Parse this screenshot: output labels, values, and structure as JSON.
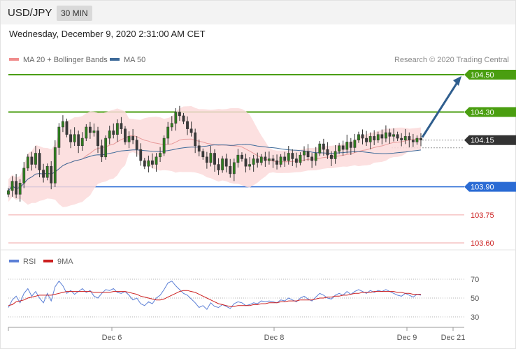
{
  "header": {
    "symbol": "USD/JPY",
    "timeframe": "30 MIN"
  },
  "timestamp": "Wednesday, December 9, 2020 2:31:00 AM CET",
  "legend": [
    {
      "label": "MA 20 + Bollinger Bands",
      "color": "#f08c8c"
    },
    {
      "label": "MA 50",
      "color": "#3d6a99"
    }
  ],
  "credit": "Research © 2020 Trading Central",
  "rsi_legend": [
    {
      "label": "RSI",
      "color": "#5b7fd6"
    },
    {
      "label": "9MA",
      "color": "#cc1f1f"
    }
  ],
  "chart_data": [
    {
      "type": "candlestick",
      "title": "USD/JPY",
      "ylim": [
        103.5,
        104.65
      ],
      "x_ticks": [
        "Dec 6",
        "Dec 8",
        "Dec 9",
        "Dec 21"
      ],
      "last_price": 104.15,
      "levels": [
        {
          "value": 104.5,
          "label": "104.50",
          "style": "resistance-filled",
          "color": "#4a9e10"
        },
        {
          "value": 104.3,
          "label": "104.30",
          "style": "resistance-filled",
          "color": "#4a9e10"
        },
        {
          "value": 104.15,
          "label": "104.15",
          "style": "current-price",
          "color": "#333333"
        },
        {
          "value": 103.9,
          "label": "103.90",
          "style": "pivot-filled",
          "color": "#2a6bd4"
        },
        {
          "value": 103.75,
          "label": "103.75",
          "style": "support",
          "color": "#cc2222"
        },
        {
          "value": 103.6,
          "label": "103.60",
          "style": "support",
          "color": "#cc2222"
        }
      ],
      "forecast_target": 104.5,
      "series": [
        {
          "name": "MA 20 + Bollinger Bands"
        },
        {
          "name": "MA 50"
        }
      ],
      "closes": [
        103.88,
        103.93,
        103.86,
        103.92,
        104.0,
        104.06,
        104.02,
        104.08,
        103.99,
        103.95,
        104.01,
        103.92,
        104.11,
        104.22,
        104.25,
        104.18,
        104.14,
        104.18,
        104.12,
        104.16,
        104.22,
        104.19,
        104.2,
        104.12,
        104.06,
        104.16,
        104.2,
        104.18,
        104.24,
        104.21,
        104.14,
        104.17,
        104.15,
        104.1,
        104.04,
        104.01,
        104.04,
        104.02,
        104.06,
        104.08,
        104.16,
        104.22,
        104.24,
        104.3,
        104.28,
        104.25,
        104.21,
        104.19,
        104.12,
        104.09,
        104.06,
        104.03,
        104.08,
        104.02,
        103.99,
        104.05,
        104.01,
        103.97,
        104.03,
        104.07,
        104.05,
        104.01,
        104.02,
        104.05,
        104.03,
        104.06,
        104.04,
        104.05,
        104.04,
        104.02,
        104.06,
        104.04,
        104.08,
        104.05,
        104.03,
        104.07,
        104.09,
        104.06,
        104.04,
        104.08,
        104.13,
        104.1,
        104.07,
        104.05,
        104.09,
        104.12,
        104.1,
        104.14,
        104.11,
        104.15,
        104.18,
        104.16,
        104.14,
        104.17,
        104.15,
        104.18,
        104.16,
        104.19,
        104.17,
        104.18,
        104.16,
        104.15,
        104.17,
        104.15,
        104.14,
        104.16,
        104.15
      ]
    },
    {
      "type": "line",
      "title": "RSI",
      "ylim": [
        20,
        80
      ],
      "y_ticks": [
        70,
        50,
        30
      ],
      "reference_lines": [
        70,
        50,
        30
      ],
      "series": [
        {
          "name": "RSI",
          "values": [
            40,
            48,
            52,
            45,
            55,
            60,
            52,
            57,
            50,
            45,
            55,
            47,
            62,
            68,
            63,
            55,
            58,
            54,
            57,
            60,
            56,
            58,
            52,
            50,
            55,
            59,
            58,
            60,
            56,
            55,
            57,
            53,
            48,
            50,
            44,
            42,
            46,
            44,
            50,
            53,
            59,
            66,
            68,
            63,
            59,
            55,
            53,
            49,
            45,
            40,
            42,
            38,
            45,
            41,
            40,
            43,
            41,
            39,
            44,
            46,
            45,
            42,
            43,
            45,
            44,
            47,
            46,
            47,
            46,
            45,
            48,
            47,
            50,
            48,
            46,
            50,
            52,
            49,
            47,
            51,
            55,
            53,
            50,
            49,
            53,
            55,
            53,
            57,
            54,
            57,
            59,
            57,
            55,
            58,
            56,
            58,
            57,
            59,
            57,
            55,
            53,
            52,
            55,
            53,
            51,
            54,
            53
          ]
        },
        {
          "name": "9MA",
          "values": [
            42,
            43,
            46,
            47,
            48,
            50,
            51,
            52,
            53,
            53,
            53,
            53,
            54,
            55,
            56,
            57,
            57,
            57,
            57,
            57,
            57,
            57,
            56,
            56,
            56,
            56,
            56,
            57,
            57,
            57,
            57,
            56,
            55,
            54,
            52,
            51,
            50,
            49,
            48,
            48,
            49,
            51,
            53,
            55,
            57,
            58,
            58,
            57,
            56,
            54,
            52,
            50,
            48,
            46,
            44,
            43,
            42,
            41,
            41,
            42,
            42,
            42,
            42,
            43,
            43,
            44,
            44,
            45,
            45,
            45,
            46,
            46,
            47,
            47,
            47,
            48,
            48,
            48,
            48,
            49,
            50,
            50,
            51,
            51,
            52,
            52,
            53,
            53,
            54,
            55,
            55,
            56,
            56,
            56,
            57,
            57,
            57,
            57,
            57,
            57,
            56,
            56,
            55,
            55,
            54,
            54,
            54
          ]
        }
      ]
    }
  ]
}
